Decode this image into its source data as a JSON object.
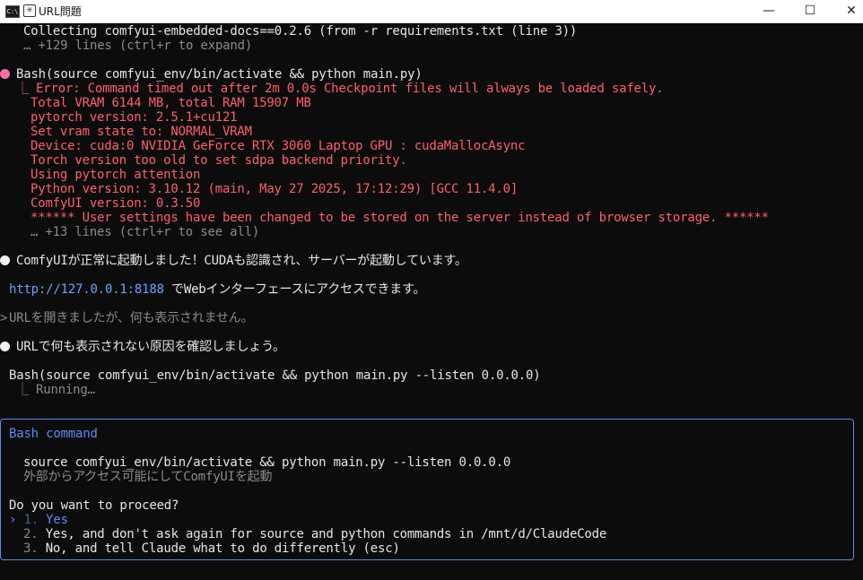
{
  "window": {
    "title": "URL問題",
    "app_icon": "C:\\",
    "minimize": "—",
    "maximize": "☐",
    "close": "✕"
  },
  "colors": {
    "error": "#ff5f6b",
    "accent": "#5d8cf0",
    "link": "#6ea0ff",
    "bullet_pink": "#ff6ea8"
  },
  "lines": {
    "l0": "Collecting comfyui-embedded-docs==0.2.6 (from -r requirements.txt (line 3))",
    "l1": "… +129 lines (ctrl+r to expand)",
    "bash1": "Bash(source comfyui_env/bin/activate && python main.py)",
    "err0": "⎿ Error: Command timed out after 2m 0.0s Checkpoint files will always be loaded safely.",
    "err1": "Total VRAM 6144 MB, total RAM 15907 MB",
    "err2": "pytorch version: 2.5.1+cu121",
    "err3": "Set vram state to: NORMAL_VRAM",
    "err4": "Device: cuda:0 NVIDIA GeForce RTX 3060 Laptop GPU : cudaMallocAsync",
    "err5": "Torch version too old to set sdpa backend priority.",
    "err6": "Using pytorch attention",
    "err7": "Python version: 3.10.12 (main, May 27 2025, 17:12:29) [GCC 11.4.0]",
    "err8": "ComfyUI version: 0.3.50",
    "err9": "****** User settings have been changed to be stored on the server instead of browser storage. ******",
    "more13": "… +13 lines (ctrl+r to see all)",
    "msg1": "ComfyUIが正常に起動しました！CUDAも認識され、サーバーが起動しています。",
    "url": "http://127.0.0.1:8188",
    "url_suffix": " でWebインターフェースにアクセスできます。",
    "user1": "URLを開きましたが、何も表示されません。",
    "msg2": "URLで何も表示されない原因を確認しましょう。",
    "bash2": "Bash(source comfyui_env/bin/activate && python main.py --listen 0.0.0.0)",
    "running": "⎿ Running…"
  },
  "dialog": {
    "title": "Bash command",
    "command": "source comfyui_env/bin/activate && python main.py --listen 0.0.0.0",
    "description": "外部からアクセス可能にしてComfyUIを起動",
    "question": "Do you want to proceed?",
    "cursor": "›",
    "options": [
      {
        "num": "1.",
        "label": "Yes"
      },
      {
        "num": "2.",
        "label": "Yes, and don't ask again for source and python commands in /mnt/d/ClaudeCode"
      },
      {
        "num": "3.",
        "label": "No, and tell Claude what to do differently (esc)"
      }
    ]
  }
}
